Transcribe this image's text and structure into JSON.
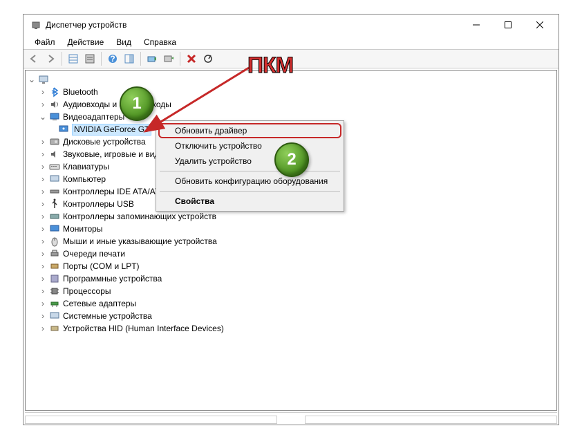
{
  "window": {
    "title": "Диспетчер устройств"
  },
  "menu": {
    "file": "Файл",
    "action": "Действие",
    "view": "Вид",
    "help": "Справка"
  },
  "tree": {
    "root": "",
    "bluetooth": "Bluetooth",
    "audio": "Аудиовходы и аудиовыходы",
    "video": "Видеоадаптеры",
    "gpu": "NVIDIA GeForce GT",
    "disk": "Дисковые устройства",
    "sound": "Звуковые, игровые и видеоустройства",
    "keyboard": "Клавиатуры",
    "computer": "Компьютер",
    "ide": "Контроллеры IDE ATA/ATAPI",
    "usb": "Контроллеры USB",
    "storage": "Контроллеры запоминающих устройств",
    "monitor": "Мониторы",
    "mouse": "Мыши и иные указывающие устройства",
    "print": "Очереди печати",
    "ports": "Порты (COM и LPT)",
    "software": "Программные устройства",
    "cpu": "Процессоры",
    "network": "Сетевые адаптеры",
    "system": "Системные устройства",
    "hid": "Устройства HID (Human Interface Devices)"
  },
  "context": {
    "update": "Обновить драйвер",
    "disable": "Отключить устройство",
    "remove": "Удалить устройство",
    "scan": "Обновить конфигурацию оборудования",
    "props": "Свойства"
  },
  "annotations": {
    "pkm": "ПКМ",
    "badge1": "1",
    "badge2": "2"
  }
}
